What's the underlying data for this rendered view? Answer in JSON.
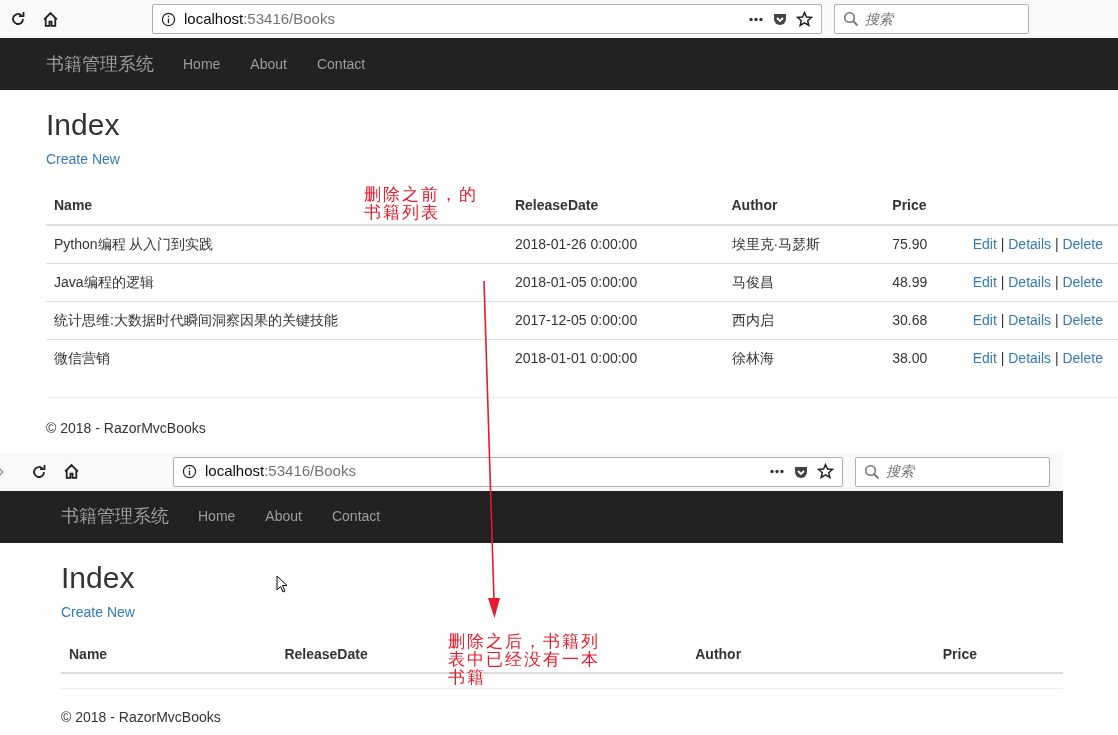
{
  "screenshots": [
    {
      "address": {
        "host": "localhost",
        "rest": ":53416/Books"
      },
      "search": {
        "placeholder": "搜索"
      },
      "brand": "书籍管理系统",
      "nav": [
        "Home",
        "About",
        "Contact"
      ],
      "title": "Index",
      "create_link": "Create New",
      "columns": [
        "Name",
        "ReleaseDate",
        "Author",
        "Price"
      ],
      "rows": [
        {
          "cells": [
            "Python编程 从入门到实践",
            "2018-01-26 0:00:00",
            "埃里克·马瑟斯",
            "75.90"
          ],
          "actions": [
            "Edit",
            "|",
            "Details",
            "|",
            "Delete"
          ]
        },
        {
          "cells": [
            "Java编程的逻辑",
            "2018-01-05 0:00:00",
            "马俊昌",
            "48.99"
          ],
          "actions": [
            "Edit",
            "|",
            "Details",
            "|",
            "Delete"
          ]
        },
        {
          "cells": [
            "统计思维:大数据时代瞬间洞察因果的关键技能",
            "2017-12-05 0:00:00",
            "西内启",
            "30.68"
          ],
          "actions": [
            "Edit",
            "|",
            "Details",
            "|",
            "Delete"
          ]
        },
        {
          "cells": [
            "微信营销",
            "2018-01-01 0:00:00",
            "徐林海",
            "38.00"
          ],
          "actions": [
            "Edit",
            "|",
            "Details",
            "|",
            "Delete"
          ]
        }
      ],
      "footer": "© 2018 - RazorMvcBooks"
    },
    {
      "address": {
        "host": "localhost",
        "rest": ":53416/Books"
      },
      "search": {
        "placeholder": "搜索"
      },
      "brand": "书籍管理系统",
      "nav": [
        "Home",
        "About",
        "Contact"
      ],
      "title": "Index",
      "create_link": "Create New",
      "columns": [
        "Name",
        "ReleaseDate",
        "Author",
        "Price"
      ],
      "footer": "© 2018 - RazorMvcBooks"
    }
  ],
  "annotations": [
    {
      "lines": [
        "删除之前，的",
        "书籍列表"
      ]
    },
    {
      "lines": [
        "删除之后，书籍列",
        "表中已经没有一本",
        "书籍"
      ]
    }
  ]
}
